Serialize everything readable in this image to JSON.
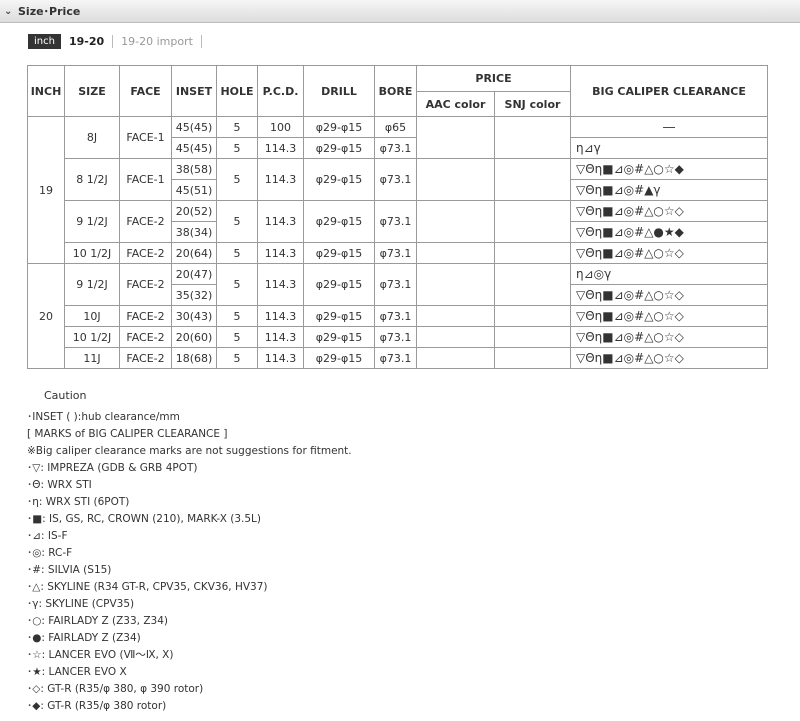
{
  "header": {
    "title": "Size･Price"
  },
  "tabs": {
    "unit": "inch",
    "active": "19-20",
    "inactive": "19-20 import"
  },
  "table": {
    "headers": {
      "inch": "INCH",
      "size": "SIZE",
      "face": "FACE",
      "inset": "INSET",
      "hole": "HOLE",
      "pcd": "P.C.D.",
      "drill": "DRILL",
      "bore": "BORE",
      "price": "PRICE",
      "aac": "AAC color",
      "snj": "SNJ color",
      "clearance": "BIG CALIPER CLEARANCE"
    },
    "inches": [
      "19",
      "20"
    ],
    "sizes": [
      {
        "size": "8J",
        "face": "FACE-1",
        "hole": "5",
        "rows": [
          {
            "inset": "45(45)",
            "pcd": "100",
            "drill": "φ29-φ15",
            "bore": "φ65",
            "clearance": "―"
          },
          {
            "inset": "45(45)",
            "pcd": "114.3",
            "drill": "φ29-φ15",
            "bore": "φ73.1",
            "clearance": "η⊿γ"
          }
        ]
      },
      {
        "size": "8 1/2J",
        "face": "FACE-1",
        "hole": "5",
        "pcd": "114.3",
        "drill": "φ29-φ15",
        "bore": "φ73.1",
        "rows": [
          {
            "inset": "38(58)",
            "clearance": "▽Θη■⊿◎#△○☆◆"
          },
          {
            "inset": "45(51)",
            "clearance": "▽Θη■⊿◎#▲γ"
          }
        ]
      },
      {
        "size": "9 1/2J",
        "face": "FACE-2",
        "hole": "5",
        "pcd": "114.3",
        "drill": "φ29-φ15",
        "bore": "φ73.1",
        "rows": [
          {
            "inset": "20(52)",
            "clearance": "▽Θη■⊿◎#△○☆◇"
          },
          {
            "inset": "38(34)",
            "clearance": "▽Θη■⊿◎#△●★◆"
          }
        ]
      },
      {
        "size": "10 1/2J",
        "face": "FACE-2",
        "hole": "5",
        "pcd": "114.3",
        "drill": "φ29-φ15",
        "bore": "φ73.1",
        "rows": [
          {
            "inset": "20(64)",
            "clearance": "▽Θη■⊿◎#△○☆◇"
          }
        ]
      },
      {
        "size": "9 1/2J",
        "face": "FACE-2",
        "hole": "5",
        "pcd": "114.3",
        "drill": "φ29-φ15",
        "bore": "φ73.1",
        "rows": [
          {
            "inset": "20(47)",
            "clearance": "η⊿◎γ"
          },
          {
            "inset": "35(32)",
            "clearance": "▽Θη■⊿◎#△○☆◇"
          }
        ]
      },
      {
        "size": "10J",
        "face": "FACE-2",
        "hole": "5",
        "pcd": "114.3",
        "drill": "φ29-φ15",
        "bore": "φ73.1",
        "rows": [
          {
            "inset": "30(43)",
            "clearance": "▽Θη■⊿◎#△○☆◇"
          }
        ]
      },
      {
        "size": "10 1/2J",
        "face": "FACE-2",
        "hole": "5",
        "pcd": "114.3",
        "drill": "φ29-φ15",
        "bore": "φ73.1",
        "rows": [
          {
            "inset": "20(60)",
            "clearance": "▽Θη■⊿◎#△○☆◇"
          }
        ]
      },
      {
        "size": "11J",
        "face": "FACE-2",
        "hole": "5",
        "pcd": "114.3",
        "drill": "φ29-φ15",
        "bore": "φ73.1",
        "rows": [
          {
            "inset": "18(68)",
            "clearance": "▽Θη■⊿◎#△○☆◇"
          }
        ]
      }
    ]
  },
  "notes": {
    "caution_title": "Caution",
    "lines": [
      "･INSET ( ):hub clearance/mm",
      "[ MARKS of BIG CALIPER CLEARANCE ]",
      "※Big caliper clearance marks are not suggestions for fitment.",
      "･▽: IMPREZA (GDB & GRB 4POT)",
      "･Θ: WRX STI",
      "･η: WRX STI (6POT)",
      "･■: IS, GS, RC, CROWN (210), MARK-X (3.5L)",
      "･⊿: IS-F",
      "･◎: RC-F",
      "･#: SILVIA (S15)",
      "･△: SKYLINE (R34 GT-R, CPV35, CKV36, HV37)",
      "･γ: SKYLINE (CPV35)",
      "･○: FAIRLADY Z (Z33, Z34)",
      "･●: FAIRLADY Z (Z34)",
      "･☆: LANCER EVO (Ⅶ〜Ⅸ, Ⅹ)",
      "･★: LANCER EVO X",
      "･◇: GT-R (R35/φ 380, φ 390 rotor)",
      "･◆: GT-R (R35/φ 380 rotor)"
    ]
  }
}
